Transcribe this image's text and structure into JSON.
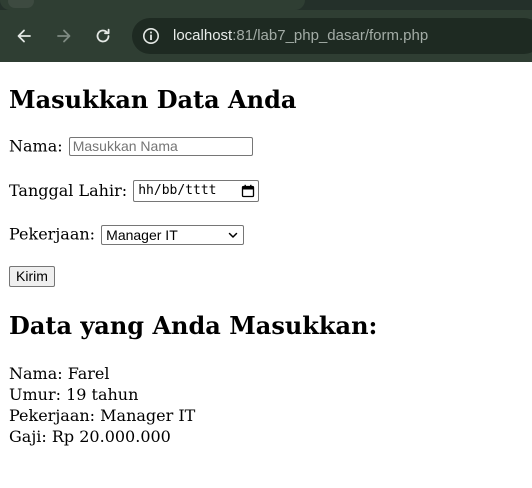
{
  "browser": {
    "url_host": "localhost",
    "url_port_path": ":81/lab7_php_dasar/form.php"
  },
  "form": {
    "title": "Masukkan Data Anda",
    "nama_label": "Nama:",
    "nama_placeholder": "Masukkan Nama",
    "tanggal_label": "Tanggal Lahir:",
    "tanggal_placeholder": "hh/bb/tttt",
    "pekerjaan_label": "Pekerjaan:",
    "pekerjaan_selected": "Manager IT",
    "submit_label": "Kirim"
  },
  "result": {
    "title": "Data yang Anda Masukkan:",
    "lines": [
      "Nama: Farel",
      "Umur: 19 tahun",
      "Pekerjaan: Manager IT",
      "Gaji: Rp 20.000.000"
    ]
  },
  "colors": {
    "chrome_bg": "#2f3e33",
    "omnibox_bg": "#1e2a22"
  },
  "icons": {
    "back": "arrow-left-icon",
    "forward": "arrow-right-icon",
    "reload": "reload-icon",
    "site_info": "site-info-icon",
    "calendar": "calendar-icon",
    "dropdown": "chevron-down-icon"
  }
}
